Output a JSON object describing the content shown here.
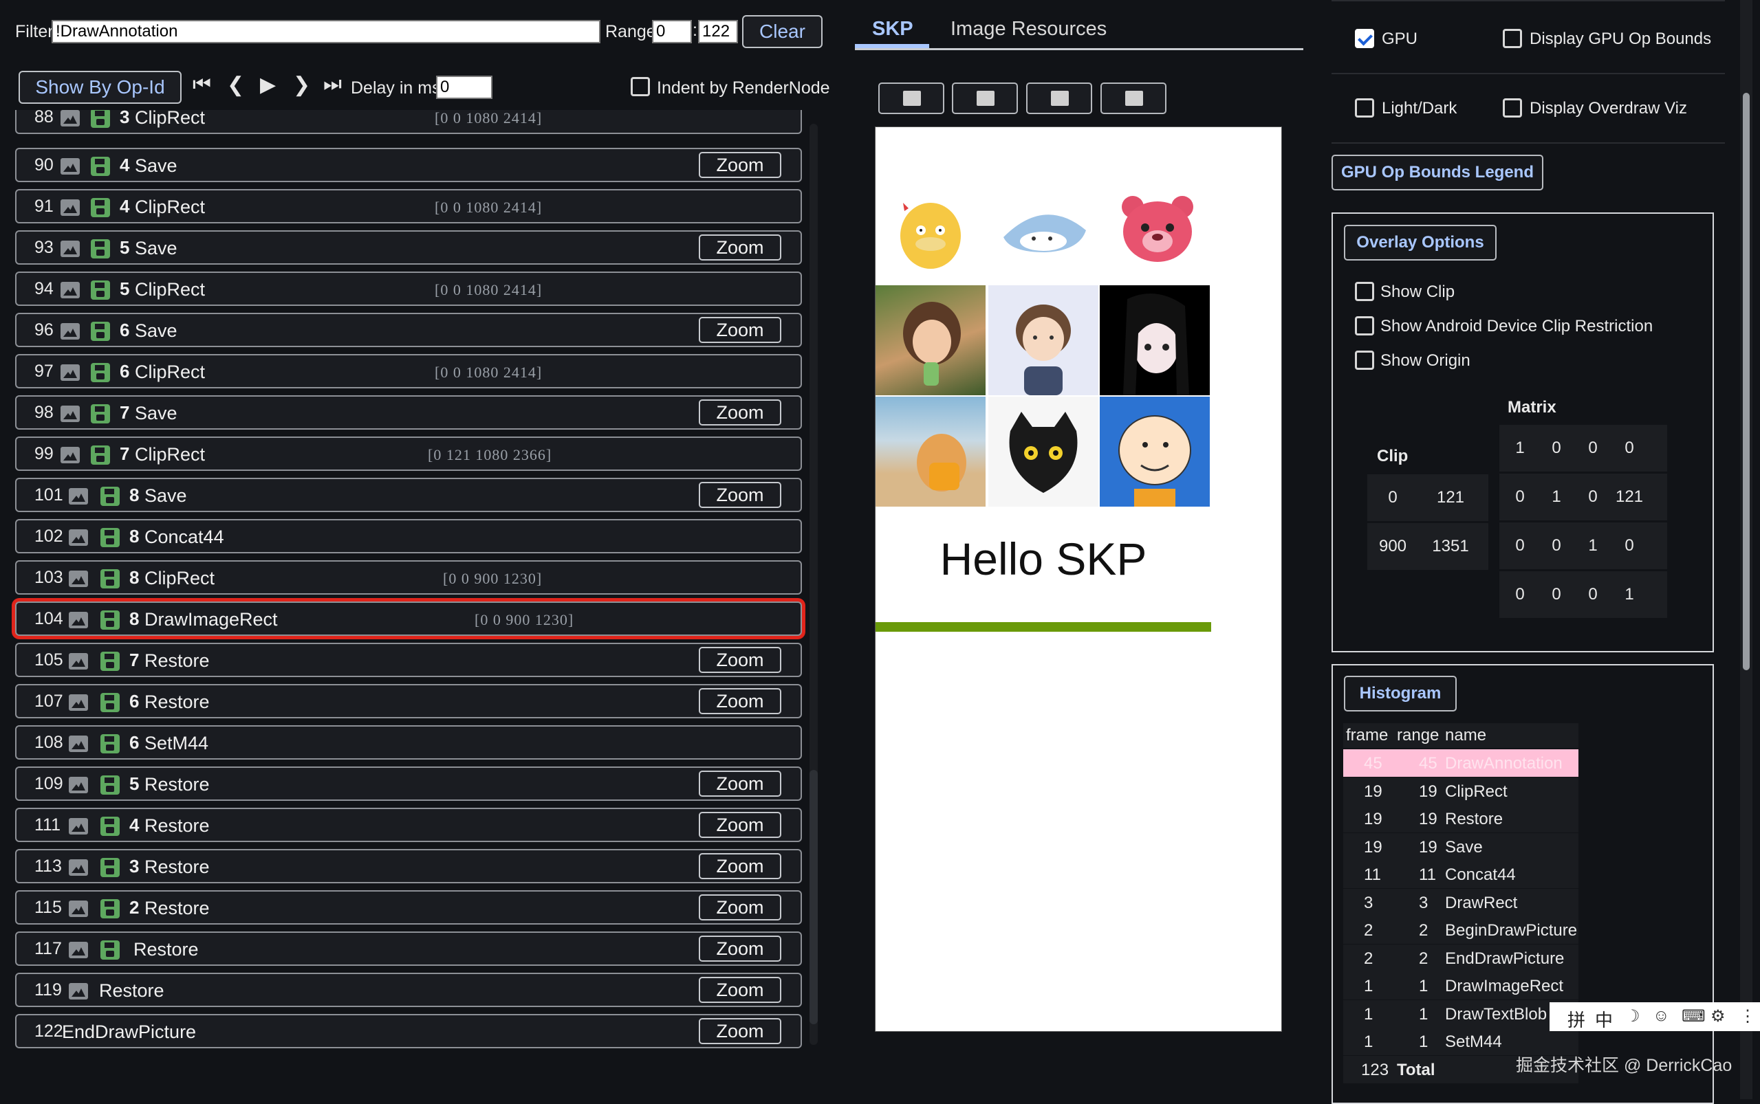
{
  "toolbar": {
    "filter_label": "Filter",
    "filter_value": "!DrawAnnotation",
    "range_label": "Range",
    "range_start": "0",
    "range_end": "122",
    "clear_label": "Clear",
    "show_by_opid_label": "Show By Op-Id",
    "delay_label": "Delay in ms",
    "delay_value": "0",
    "indent_label": "Indent by RenderNode"
  },
  "commands": [
    {
      "id": "88",
      "depth": "3",
      "name": "ClipRect",
      "bounds": "[0 0 1080 2414]",
      "zoom": "",
      "icons": "img-save",
      "partial": true
    },
    {
      "id": "90",
      "depth": "4",
      "name": "Save",
      "bounds": "",
      "zoom": "Zoom",
      "icons": "img-save"
    },
    {
      "id": "91",
      "depth": "4",
      "name": "ClipRect",
      "bounds": "[0 0 1080 2414]",
      "zoom": "",
      "icons": "img-save"
    },
    {
      "id": "93",
      "depth": "5",
      "name": "Save",
      "bounds": "",
      "zoom": "Zoom",
      "icons": "img-save"
    },
    {
      "id": "94",
      "depth": "5",
      "name": "ClipRect",
      "bounds": "[0 0 1080 2414]",
      "zoom": "",
      "icons": "img-save"
    },
    {
      "id": "96",
      "depth": "6",
      "name": "Save",
      "bounds": "",
      "zoom": "Zoom",
      "icons": "img-save"
    },
    {
      "id": "97",
      "depth": "6",
      "name": "ClipRect",
      "bounds": "[0 0 1080 2414]",
      "zoom": "",
      "icons": "img-save"
    },
    {
      "id": "98",
      "depth": "7",
      "name": "Save",
      "bounds": "",
      "zoom": "Zoom",
      "icons": "img-save"
    },
    {
      "id": "99",
      "depth": "7",
      "name": "ClipRect",
      "bounds": "[0 121 1080 2366]",
      "zoom": "",
      "icons": "img-save"
    },
    {
      "id": "101",
      "depth": "8",
      "name": "Save",
      "bounds": "",
      "zoom": "Zoom",
      "icons": "img-save"
    },
    {
      "id": "102",
      "depth": "8",
      "name": "Concat44",
      "bounds": "",
      "zoom": "",
      "icons": "img-save"
    },
    {
      "id": "103",
      "depth": "8",
      "name": "ClipRect",
      "bounds": "[0 0 900 1230]",
      "zoom": "",
      "icons": "img-save"
    },
    {
      "id": "104",
      "depth": "8",
      "name": "DrawImageRect",
      "bounds": "[0 0 900 1230]",
      "zoom": "",
      "icons": "img-save",
      "selected": true
    },
    {
      "id": "105",
      "depth": "7",
      "name": "Restore",
      "bounds": "",
      "zoom": "Zoom",
      "icons": "img-save"
    },
    {
      "id": "107",
      "depth": "6",
      "name": "Restore",
      "bounds": "",
      "zoom": "Zoom",
      "icons": "img-save"
    },
    {
      "id": "108",
      "depth": "6",
      "name": "SetM44",
      "bounds": "",
      "zoom": "",
      "icons": "img-save"
    },
    {
      "id": "109",
      "depth": "5",
      "name": "Restore",
      "bounds": "",
      "zoom": "Zoom",
      "icons": "img-save"
    },
    {
      "id": "111",
      "depth": "4",
      "name": "Restore",
      "bounds": "",
      "zoom": "Zoom",
      "icons": "img-save"
    },
    {
      "id": "113",
      "depth": "3",
      "name": "Restore",
      "bounds": "",
      "zoom": "Zoom",
      "icons": "img-save"
    },
    {
      "id": "115",
      "depth": "2",
      "name": "Restore",
      "bounds": "",
      "zoom": "Zoom",
      "icons": "img-save"
    },
    {
      "id": "117",
      "depth": "",
      "name": "Restore",
      "bounds": "",
      "zoom": "Zoom",
      "icons": "img-save"
    },
    {
      "id": "119",
      "depth": "",
      "name": "Restore",
      "bounds": "",
      "zoom": "Zoom",
      "icons": "img"
    },
    {
      "id": "122",
      "depth": "",
      "name": "EndDrawPicture",
      "bounds": "",
      "zoom": "Zoom",
      "icons": "none"
    }
  ],
  "tabs": {
    "skp": "SKP",
    "image_resources": "Image Resources"
  },
  "canvas": {
    "hello_text": "Hello SKP",
    "accent": "#6a9a0a"
  },
  "options": {
    "gpu_label": "GPU",
    "gpu_checked": true,
    "gpu_bounds_label": "Display GPU Op Bounds",
    "light_dark_label": "Light/Dark",
    "overdraw_label": "Display Overdraw Viz",
    "legend_button": "GPU Op Bounds Legend",
    "overlay_button": "Overlay Options",
    "show_clip": "Show Clip",
    "show_android_clip": "Show Android Device Clip Restriction",
    "show_origin": "Show Origin"
  },
  "matrix": {
    "title": "Matrix",
    "rows": [
      [
        "1",
        "0",
        "0",
        "0"
      ],
      [
        "0",
        "1",
        "0",
        "121"
      ],
      [
        "0",
        "0",
        "1",
        "0"
      ],
      [
        "0",
        "0",
        "0",
        "1"
      ]
    ]
  },
  "clip": {
    "title": "Clip",
    "rows": [
      [
        "0",
        "121"
      ],
      [
        "900",
        "1351"
      ]
    ]
  },
  "histogram": {
    "button": "Histogram",
    "headers": {
      "frame": "frame",
      "range": "range",
      "name": "name"
    },
    "rows": [
      {
        "frame": "45",
        "range": "45",
        "name": "DrawAnnotation",
        "highlight": true
      },
      {
        "frame": "19",
        "range": "19",
        "name": "ClipRect"
      },
      {
        "frame": "19",
        "range": "19",
        "name": "Restore"
      },
      {
        "frame": "19",
        "range": "19",
        "name": "Save"
      },
      {
        "frame": "11",
        "range": "11",
        "name": "Concat44"
      },
      {
        "frame": "3",
        "range": "3",
        "name": "DrawRect"
      },
      {
        "frame": "2",
        "range": "2",
        "name": "BeginDrawPicture"
      },
      {
        "frame": "2",
        "range": "2",
        "name": "EndDrawPicture"
      },
      {
        "frame": "1",
        "range": "1",
        "name": "DrawImageRect"
      },
      {
        "frame": "1",
        "range": "1",
        "name": "DrawTextBlob"
      },
      {
        "frame": "1",
        "range": "1",
        "name": "SetM44"
      }
    ],
    "total_count": "123",
    "total_label": "Total"
  },
  "ime_toolbar": {
    "pinyin": "拼",
    "zhong": "中"
  },
  "watermark": "掘金技术社区 @ DerrickCao",
  "colors": {
    "selection_outline": "#e0241b",
    "accent_blue": "#a9c7ff",
    "highlight_row": "#ffc0d8",
    "save_green": "#5ea85f"
  }
}
